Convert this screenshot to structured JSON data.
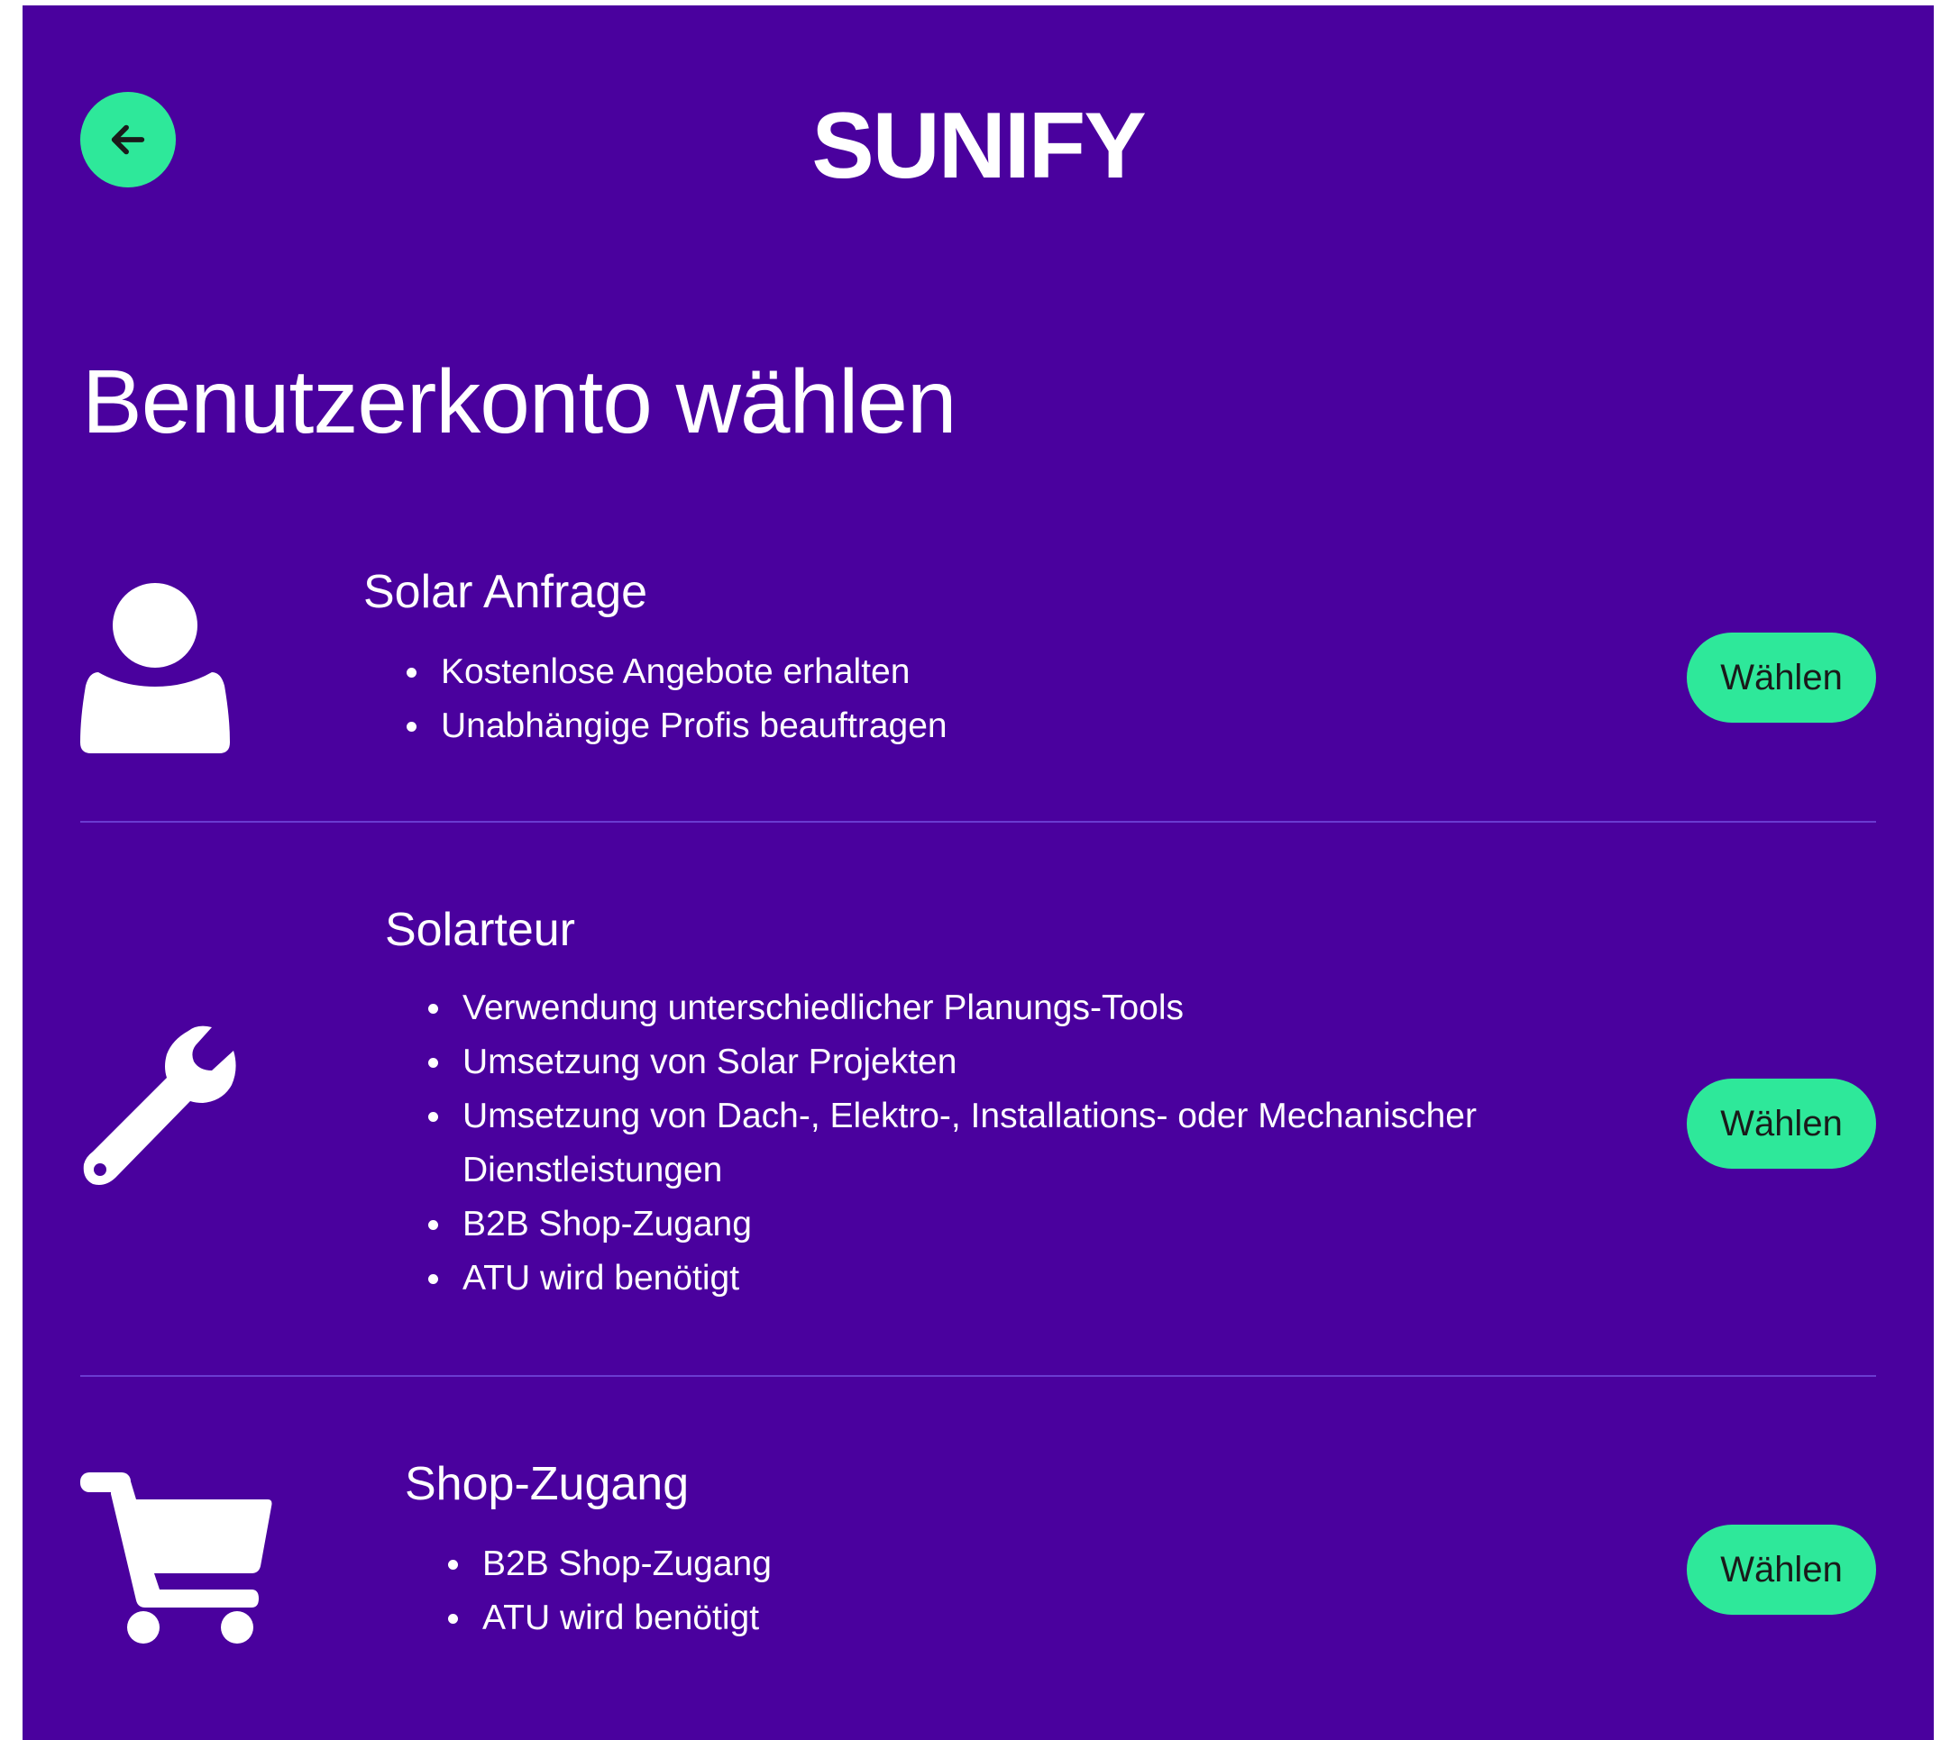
{
  "header": {
    "brand": "SUNIFY",
    "back_icon": "arrow-left-icon"
  },
  "page_title": "Benutzerkonto wählen",
  "accounts": [
    {
      "icon": "user-icon",
      "title": "Solar Anfrage",
      "features": [
        "Kostenlose Angebote erhalten",
        "Unabhängige Profis beauftragen"
      ],
      "button_label": "Wählen"
    },
    {
      "icon": "wrench-icon",
      "title": "Solarteur",
      "features": [
        "Verwendung unterschiedlicher Planungs-Tools",
        "Umsetzung von Solar Projekten",
        "Umsetzung von Dach-, Elektro-, Installations- oder Mechanischer Dienstleistungen",
        "B2B Shop-Zugang",
        "ATU wird benötigt"
      ],
      "button_label": "Wählen"
    },
    {
      "icon": "cart-icon",
      "title": "Shop-Zugang",
      "features": [
        "B2B Shop-Zugang",
        "ATU wird benötigt"
      ],
      "button_label": "Wählen"
    }
  ],
  "colors": {
    "background": "#4a019e",
    "accent": "#2ee89a",
    "text": "#ffffff",
    "divider": "#6a3bd0"
  }
}
